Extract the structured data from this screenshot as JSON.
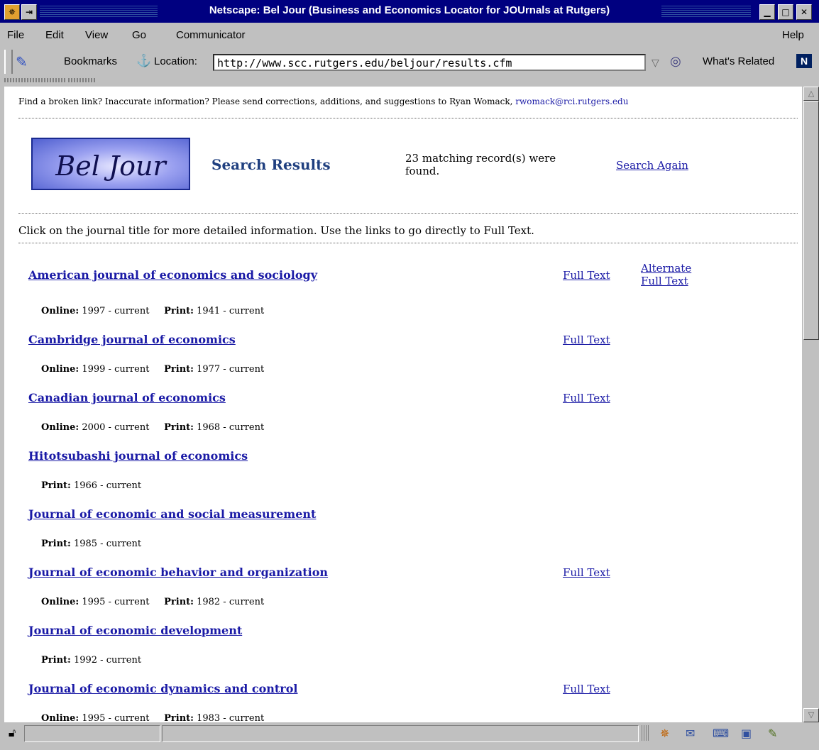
{
  "window": {
    "title": "Netscape: Bel Jour (Business and Economics Locator for JOUrnals at Rutgers)"
  },
  "menu": [
    "File",
    "Edit",
    "View",
    "Go",
    "Communicator"
  ],
  "menu_help": "Help",
  "toolbar": {
    "bookmarks": "Bookmarks",
    "location_label": "Location:",
    "url": "http://www.scc.rutgers.edu/beljour/results.cfm",
    "whats_related": "What's Related"
  },
  "page": {
    "notice_text": "Find a broken link? Inaccurate information? Please send corrections, additions, and suggestions to Ryan Womack,",
    "notice_email": "rwomack@rci.rutgers.edu",
    "logo_text": "Bel Jour",
    "heading": "Search Results",
    "count_text": "23 matching record(s) were found.",
    "search_again": "Search Again",
    "instructions": "Click on the journal title for more detailed information. Use the links to go directly to Full Text.",
    "online_label": "Online:",
    "print_label": "Print:",
    "full_text_label": "Full Text",
    "alternate_line1": "Alternate",
    "alternate_line2": "Full Text"
  },
  "results": [
    {
      "title": "American journal of economics and sociology",
      "online": "1997 - current",
      "print": "1941 - current",
      "full_text": true,
      "alternate": true
    },
    {
      "title": "Cambridge journal of economics",
      "online": "1999 - current",
      "print": "1977 - current",
      "full_text": true,
      "alternate": false
    },
    {
      "title": "Canadian journal of economics",
      "online": "2000 - current",
      "print": "1968 - current",
      "full_text": true,
      "alternate": false
    },
    {
      "title": "Hitotsubashi journal of economics",
      "online": null,
      "print": "1966 - current",
      "full_text": false,
      "alternate": false
    },
    {
      "title": "Journal of economic and social measurement",
      "online": null,
      "print": "1985 - current",
      "full_text": false,
      "alternate": false
    },
    {
      "title": "Journal of economic behavior and organization",
      "online": "1995 - current",
      "print": "1982 - current",
      "full_text": true,
      "alternate": false
    },
    {
      "title": "Journal of economic development",
      "online": null,
      "print": "1992 - current",
      "full_text": false,
      "alternate": false
    },
    {
      "title": "Journal of economic dynamics and control",
      "online": "1995 - current",
      "print": "1983 - current",
      "full_text": true,
      "alternate": false
    }
  ],
  "colors": {
    "titlebar": "#000080",
    "link": "#1a1aa6",
    "heading": "#1f3f7f"
  }
}
